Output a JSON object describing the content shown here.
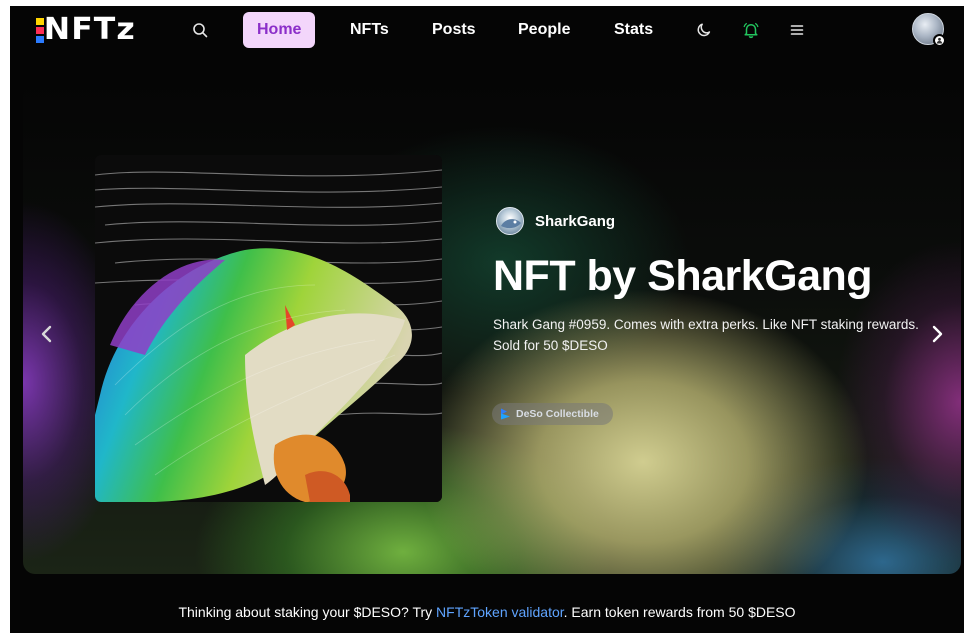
{
  "header": {
    "logo_text": "NFTz",
    "logo_colors": [
      "#ffd400",
      "#ff2d55",
      "#2b7bff"
    ],
    "search_icon": "search-icon",
    "nav": [
      {
        "label": "Home",
        "active": true
      },
      {
        "label": "NFTs",
        "active": false
      },
      {
        "label": "Posts",
        "active": false
      },
      {
        "label": "People",
        "active": false
      },
      {
        "label": "Stats",
        "active": false
      }
    ],
    "theme_icon": "moon-icon",
    "notification_icon": "bell-icon",
    "menu_icon": "hamburger-icon",
    "accent_color": "#8b2fc9",
    "active_bg": "#f3d6fb",
    "bell_color": "#22c55e"
  },
  "hero": {
    "creator_name": "SharkGang",
    "title": "NFT by SharkGang",
    "description_line1": "Shark Gang #0959. Comes with extra perks. Like NFT staking rewards.",
    "description_line2": "Sold for 50 $DESO",
    "badge_label": "DeSo Collectible",
    "prev_icon": "chevron-left-icon",
    "next_icon": "chevron-right-icon"
  },
  "footer": {
    "text_before": "Thinking about staking your $DESO? Try ",
    "link_text": "NFTzToken validator",
    "text_after": ". Earn token rewards from 50 $DESO",
    "link_color": "#5fa4ff"
  }
}
